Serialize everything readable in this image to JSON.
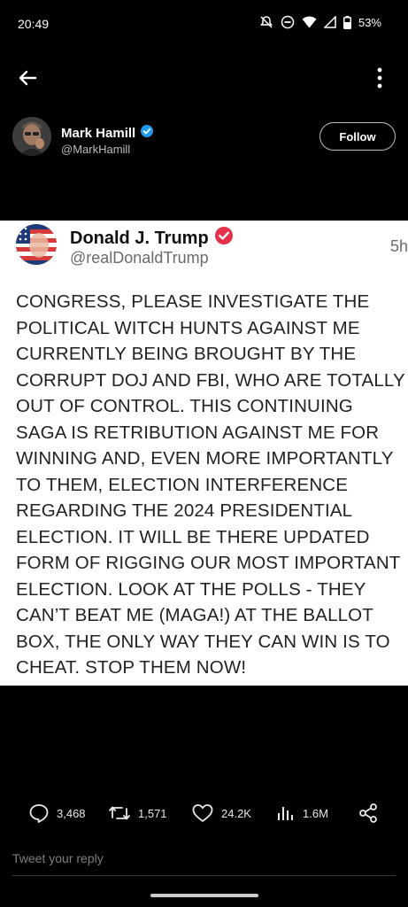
{
  "status_bar": {
    "time": "20:49",
    "battery": "53%",
    "icons": [
      "notifications-off-icon",
      "do-not-disturb-icon",
      "wifi-icon",
      "cellular-signal-icon",
      "battery-icon"
    ]
  },
  "nav": {
    "back_icon": "arrow-left-icon",
    "more_icon": "more-vertical-icon"
  },
  "author": {
    "name": "Mark Hamill",
    "handle": "@MarkHamill",
    "verified": true,
    "follow_label": "Follow"
  },
  "embedded_post": {
    "name": "Donald J. Trump",
    "handle": "@realDonaldTrump",
    "time": "5h",
    "verified_color": "#e5324a",
    "lines": [
      "CONGRESS, PLEASE INVESTIGATE THE",
      "POLITICAL WITCH HUNTS AGAINST ME",
      "CURRENTLY BEING BROUGHT BY THE",
      "CORRUPT DOJ AND FBI, WHO ARE TOTALLY",
      "OUT OF CONTROL. THIS CONTINUING",
      "SAGA IS RETRIBUTION AGAINST ME FOR",
      "WINNING AND, EVEN MORE IMPORTANTLY",
      "TO THEM, ELECTION INTERFERENCE",
      "REGARDING THE 2024 PRESIDENTIAL",
      "ELECTION. IT WILL BE THERE UPDATED",
      "FORM OF RIGGING OUR MOST IMPORTANT",
      "ELECTION. LOOK AT THE POLLS - THEY",
      "CAN’T BEAT ME (MAGA!) AT THE BALLOT",
      "BOX, THE ONLY WAY THEY CAN WIN IS TO",
      "CHEAT. STOP THEM NOW!"
    ]
  },
  "actions": {
    "replies": "3,468",
    "reposts": "1,571",
    "likes": "24.2K",
    "views": "1.6M"
  },
  "reply": {
    "placeholder": "Tweet your reply"
  },
  "colors": {
    "verified_blue": "#1d9bf0",
    "background": "#000000"
  }
}
